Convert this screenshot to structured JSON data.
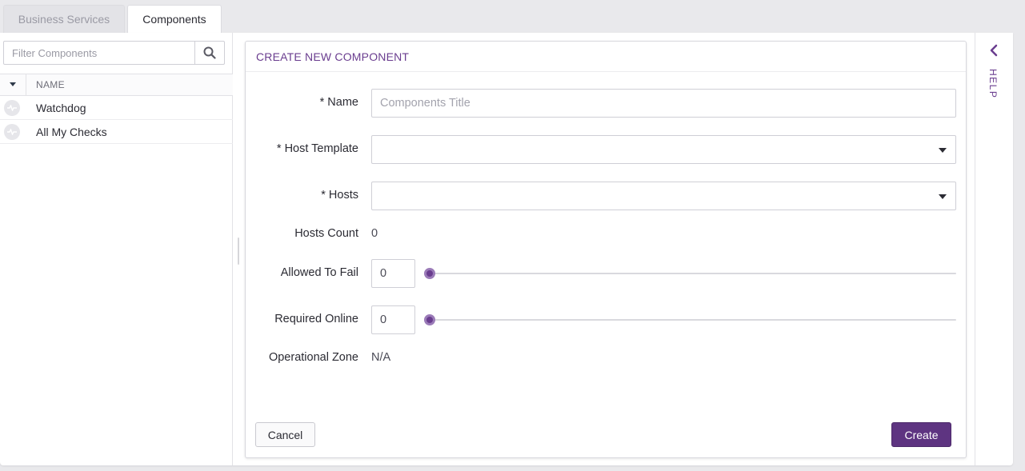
{
  "tabs": [
    {
      "label": "Business Services",
      "active": false
    },
    {
      "label": "Components",
      "active": true
    }
  ],
  "sidebar": {
    "filter_placeholder": "Filter Components",
    "column_header": "NAME",
    "items": [
      {
        "label": "Watchdog",
        "icon": "heartbeat-icon"
      },
      {
        "label": "All My Checks",
        "icon": "heartbeat-icon"
      }
    ]
  },
  "form": {
    "title": "CREATE NEW COMPONENT",
    "name": {
      "label": "* Name",
      "placeholder": "Components Title",
      "value": ""
    },
    "host_template": {
      "label": "* Host Template",
      "value": ""
    },
    "hosts": {
      "label": "* Hosts",
      "value": ""
    },
    "hosts_count": {
      "label": "Hosts Count",
      "value": "0"
    },
    "allowed_to_fail": {
      "label": "Allowed To Fail",
      "value": "0",
      "slider_fraction": 0
    },
    "required_online": {
      "label": "Required Online",
      "value": "0",
      "slider_fraction": 0
    },
    "operational_zone": {
      "label": "Operational Zone",
      "value": "N/A"
    },
    "cancel_label": "Cancel",
    "create_label": "Create"
  },
  "help": {
    "label": "HELP"
  },
  "colors": {
    "accent": "#6a3d8f",
    "primary_button": "#5e3481"
  }
}
